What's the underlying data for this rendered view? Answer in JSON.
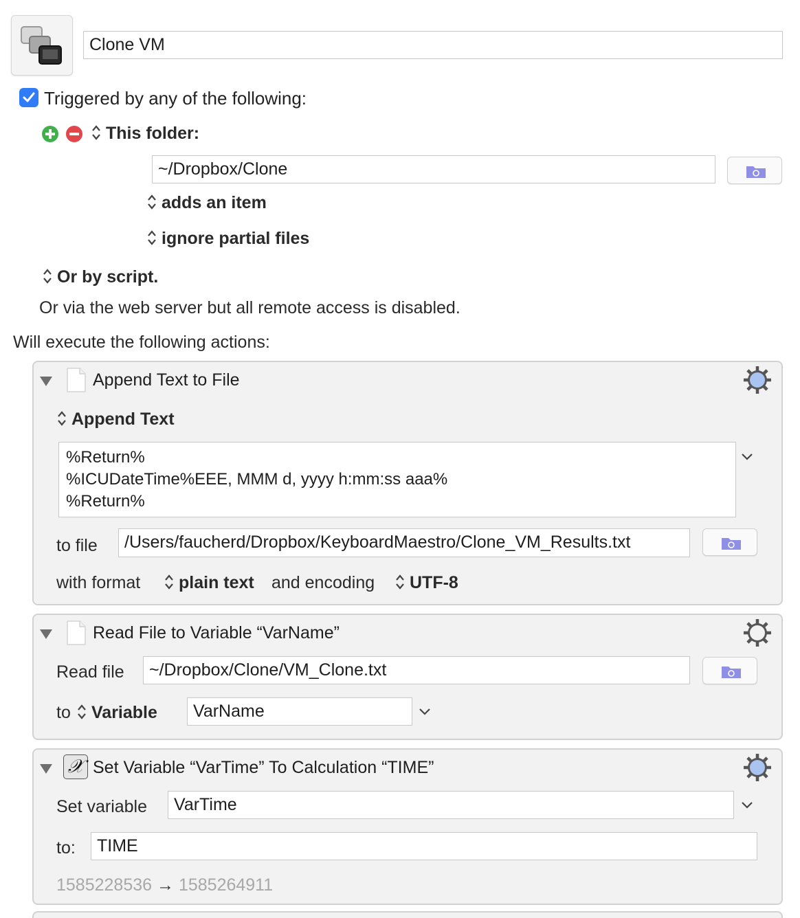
{
  "macro": {
    "name": "Clone VM",
    "icon": "macro-vm-icon"
  },
  "trigger": {
    "checkbox_checked": true,
    "heading": "Triggered by any of the following:",
    "add_icon": "plus-circle-icon",
    "remove_icon": "minus-circle-icon",
    "type_label": "This folder:",
    "folder_path": "~/Dropbox/Clone",
    "event_label": "adds an item",
    "partial_label": "ignore partial files",
    "script_label": "Or by script.",
    "web_server_note": "Or via the web server but all remote access is disabled."
  },
  "actions_heading": "Will execute the following actions:",
  "actions": [
    {
      "title": "Append Text to File",
      "mode_label": "Append Text",
      "text_lines": [
        "%Return%",
        "%ICUDateTime%EEE, MMM d, yyyy h:mm:ss aaa%",
        "%Return%"
      ],
      "to_file_label": "to file",
      "file_path": "/Users/faucherd/Dropbox/KeyboardMaestro/Clone_VM_Results.txt",
      "format_label": "with format",
      "format_value": "plain text",
      "encoding_label": "and encoding",
      "encoding_value": "UTF-8"
    },
    {
      "title": "Read File to Variable “VarName”",
      "read_label": "Read file",
      "file_path": "~/Dropbox/Clone/VM_Clone.txt",
      "to_label": "to",
      "target_label": "Variable",
      "variable_value": "VarName"
    },
    {
      "title": "Set Variable “VarTime” To Calculation “TIME”",
      "icon": "variable-x-icon",
      "set_label": "Set variable",
      "variable_value": "VarTime",
      "to_label": "to:",
      "calc_value": "TIME",
      "preview_from": "1585228536",
      "preview_arrow": "→",
      "preview_to": "1585264911"
    }
  ],
  "colors": {
    "accent": "#2f7cf6",
    "add_green": "#3fb04a",
    "remove_red": "#e0464a",
    "gear_blue": "#a9c4f0",
    "folder_purple": "#8f8fe6",
    "panel_bg": "#f2f2f2"
  }
}
